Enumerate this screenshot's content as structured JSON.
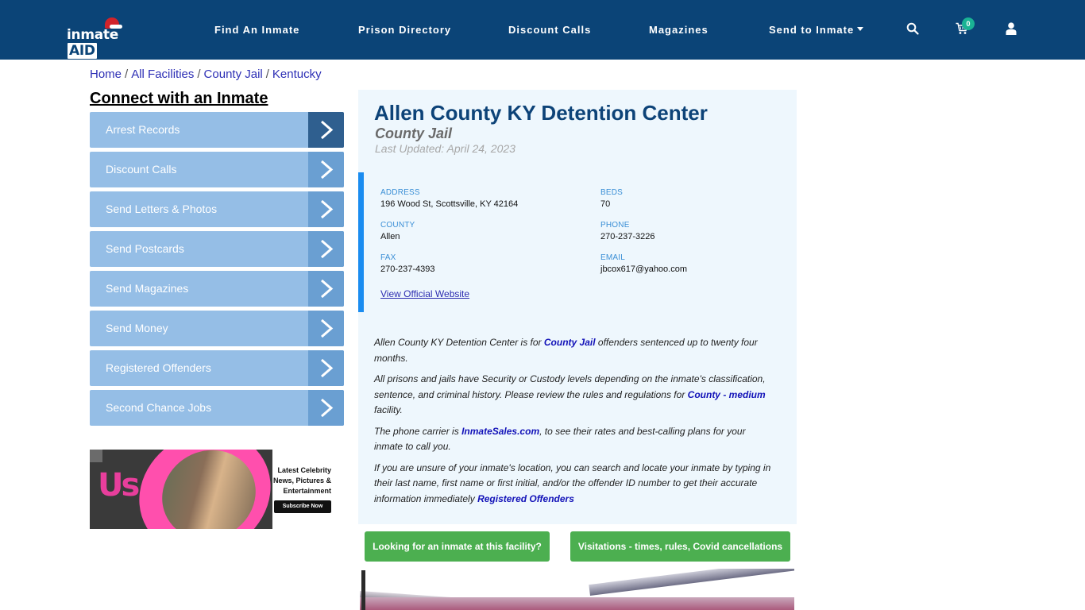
{
  "navbar": {
    "logo_text": "inmate",
    "logo_accent": "AID",
    "links": [
      {
        "label": "Find An Inmate"
      },
      {
        "label": "Prison Directory"
      },
      {
        "label": "Discount Calls"
      },
      {
        "label": "Magazines"
      },
      {
        "label": "Send to Inmate",
        "has_dropdown": true
      }
    ],
    "icons": [
      "search-icon",
      "cart-icon",
      "user-icon"
    ],
    "cart_count": "0",
    "colors": {
      "background": "#0b4477",
      "badge": "#1ab394"
    }
  },
  "breadcrumb": [
    {
      "label": "Home"
    },
    {
      "label": "All Facilities"
    },
    {
      "label": "County Jail"
    },
    {
      "label": "Kentucky"
    }
  ],
  "breadcrumb_separator": "/",
  "sidebar": {
    "title": "Connect with an Inmate",
    "items": [
      {
        "label": "Arrest Records",
        "active": true
      },
      {
        "label": "Discount Calls"
      },
      {
        "label": "Send Letters & Photos"
      },
      {
        "label": "Send Postcards"
      },
      {
        "label": "Send Magazines"
      },
      {
        "label": "Send Money"
      },
      {
        "label": "Registered Offenders"
      },
      {
        "label": "Second Chance Jobs"
      }
    ],
    "ad": {
      "brand": "Us",
      "headline": "Latest Celebrity News, Pictures & Entertainment",
      "cta": "Subscribe Now"
    }
  },
  "facility": {
    "name": "Allen County KY Detention Center",
    "type": "County Jail",
    "last_updated": "Last Updated: April 24, 2023",
    "fields": {
      "address": {
        "label": "ADDRESS",
        "value": "196 Wood St, Scottsville, KY 42164"
      },
      "beds": {
        "label": "BEDS",
        "value": "70"
      },
      "county": {
        "label": "COUNTY",
        "value": "Allen"
      },
      "phone": {
        "label": "PHONE",
        "value": "270-237-3226"
      },
      "fax": {
        "label": "FAX",
        "value": "270-237-4393"
      },
      "email": {
        "label": "EMAIL",
        "value": "jbcox617@yahoo.com"
      }
    },
    "website_link": "View Official Website"
  },
  "description": {
    "p1": {
      "before": "Allen County KY Detention Center is for ",
      "link": "County Jail",
      "after": " offenders sentenced up to twenty four months."
    },
    "p2": {
      "before": "All prisons and jails have Security or Custody levels depending on the inmate's classification, sentence, and criminal history. Please review the rules and regulations for ",
      "link": "County - medium",
      "after": " facility."
    },
    "p3": {
      "before": "The phone carrier is ",
      "link": "InmateSales.com",
      "after": ", to see their rates and best-calling plans for your inmate to call you."
    },
    "p4": {
      "before": "If you are unsure of your inmate's location, you can search and locate your inmate by typing in their last name, first name or first initial, and/or the offender ID number to get their accurate information immediately ",
      "link": "Registered Offenders",
      "after": ""
    }
  },
  "buttons": {
    "find_inmate": "Looking for an inmate at this facility?",
    "visitation": "Visitations - times, rules, Covid cancellations"
  }
}
